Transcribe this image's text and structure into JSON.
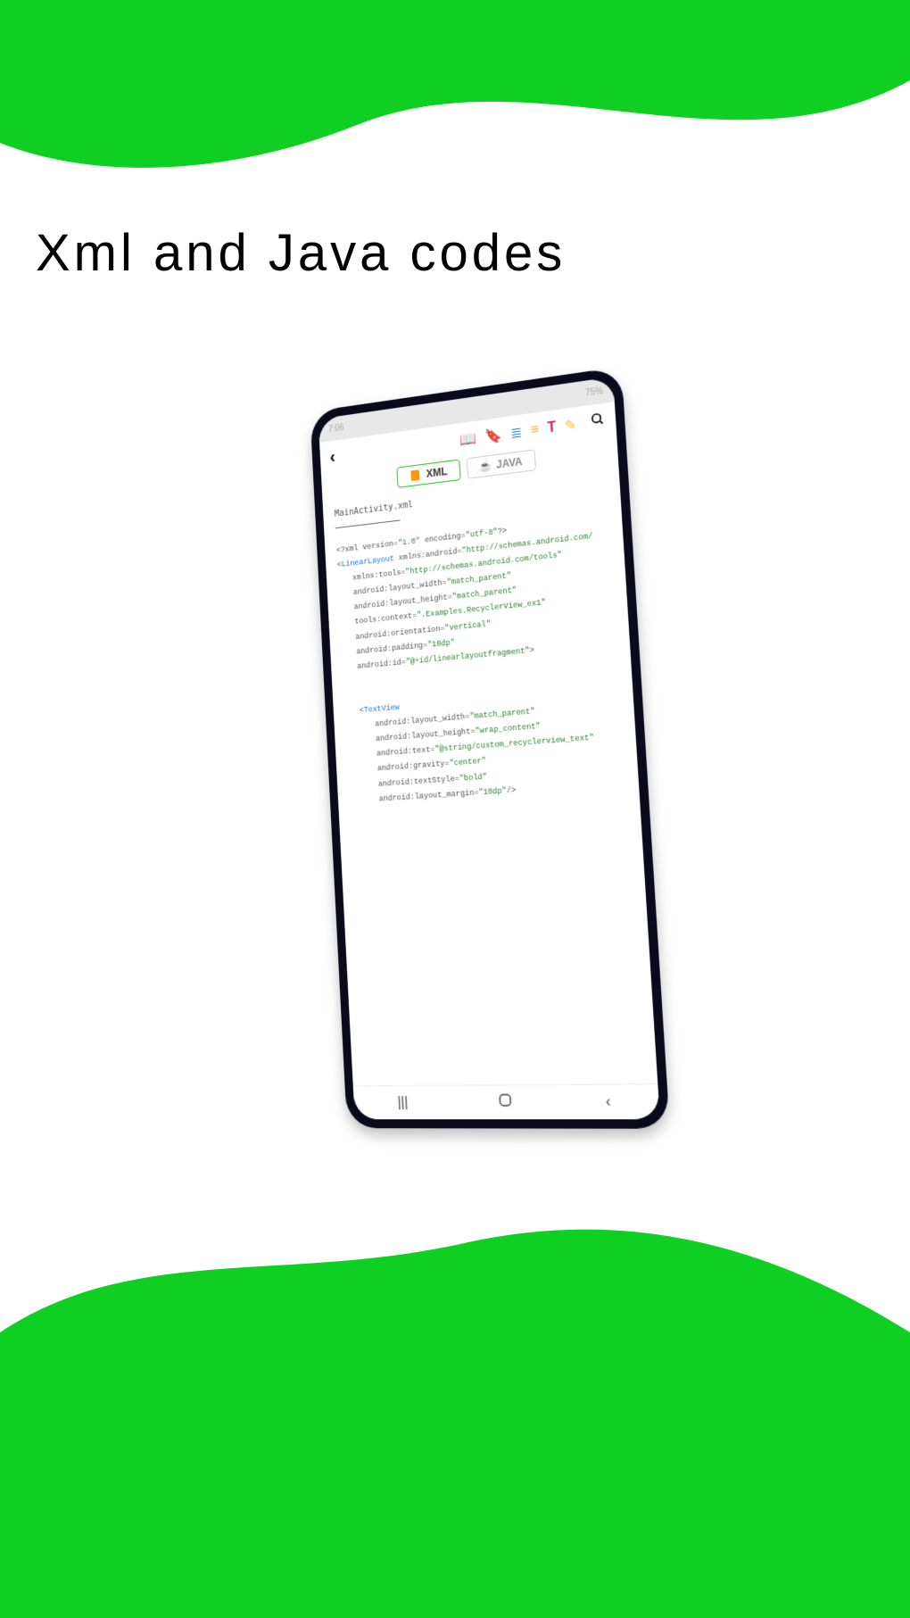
{
  "heading": "Xml and Java codes",
  "status": {
    "time": "7:06",
    "battery": "75%"
  },
  "tabs": {
    "xml": "XML",
    "java": "JAVA"
  },
  "filename": "MainActivity.xml",
  "code": {
    "l1_pre": "<?xml version=",
    "l1_v1": "\"1.0\"",
    "l1_mid": " encoding=",
    "l1_v2": "\"utf-8\"",
    "l1_end": "?>",
    "l2_open": "<",
    "l2_tag": "LinearLayout",
    "l2_attr": " xmlns:android=",
    "l2_val": "\"http://schemas.android.com/",
    "l3_attr": "xmlns:tools=",
    "l3_val": "\"http://schemas.android.com/tools\"",
    "l4_attr": "android:layout_width=",
    "l4_val": "\"match_parent\"",
    "l5_attr": "android:layout_height=",
    "l5_val": "\"match_parent\"",
    "l6_attr": "tools:context=",
    "l6_val": "\".Examples.RecyclerView_ex1\"",
    "l7_attr": "android:orientation=",
    "l7_val": "\"vertical\"",
    "l8_attr": "android:padding=",
    "l8_val": "\"10dp\"",
    "l9_attr": "android:id=",
    "l9_val": "\"@+id/linearlayoutfragment\"",
    "l9_end": ">",
    "l10_open": "<",
    "l10_tag": "TextView",
    "l11_attr": "android:layout_width=",
    "l11_val": "\"match_parent\"",
    "l12_attr": "android:layout_height=",
    "l12_val": "\"wrap_content\"",
    "l13_attr": "android:text=",
    "l13_val": "\"@string/custom_recyclerview_text\"",
    "l14_attr": "android:gravity=",
    "l14_val": "\"center\"",
    "l15_attr": "android:textStyle=",
    "l15_val": "\"bold\"",
    "l16_attr": "android:layout_margin=",
    "l16_val": "\"10dp\"",
    "l16_end": "/>"
  }
}
